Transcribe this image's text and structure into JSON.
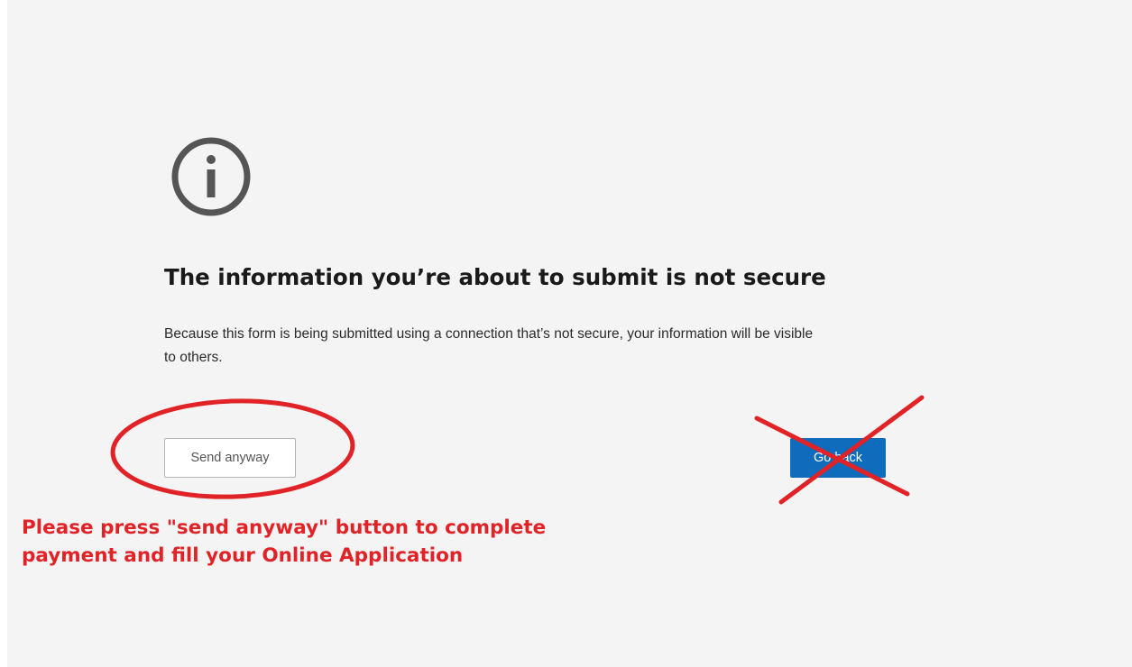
{
  "dialog": {
    "icon": "info-circle-icon",
    "title": "The information you’re about to submit is not secure",
    "description": "Because this form is being submitted using a connection that’s not secure, your information will be visible to others.",
    "send_anyway_label": "Send anyway",
    "go_back_label": "Go back"
  },
  "annotation": {
    "instruction_line1": "Please press \"send anyway\" button to complete",
    "instruction_line2": "payment and fill your Online Application",
    "circle_target": "send-anyway-button",
    "cross_target": "go-back-button"
  },
  "colors": {
    "background": "#f4f4f4",
    "title_text": "#1a1a1a",
    "primary_button": "#0f6cbd",
    "annotation_red": "#e12226"
  }
}
